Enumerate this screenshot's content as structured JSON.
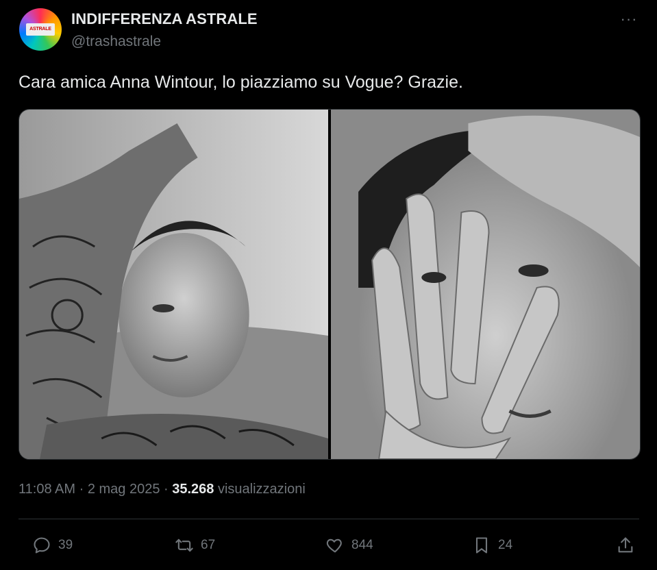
{
  "author": {
    "name": "INDIFFERENZA ASTRALE",
    "handle": "@trashastrale",
    "avatar_text": "ASTRALE"
  },
  "more_label": "···",
  "tweet": {
    "text": "Cara amica Anna Wintour, lo piazziamo su Vogue? Grazie."
  },
  "meta": {
    "time": "11:08 AM",
    "sep1": " · ",
    "date": "2 mag 2025",
    "sep2": " · ",
    "views_count": "35.268",
    "views_label": " visualizzazioni"
  },
  "actions": {
    "replies": "39",
    "reposts": "67",
    "likes": "844",
    "bookmarks": "24"
  },
  "icons": {
    "reply": "reply-icon",
    "repost": "repost-icon",
    "like": "heart-icon",
    "bookmark": "bookmark-icon",
    "share": "share-icon",
    "more": "more-icon"
  },
  "colors": {
    "background": "#000000",
    "text": "#e7e9ea",
    "secondary": "#71767b",
    "divider": "#2f3336"
  }
}
